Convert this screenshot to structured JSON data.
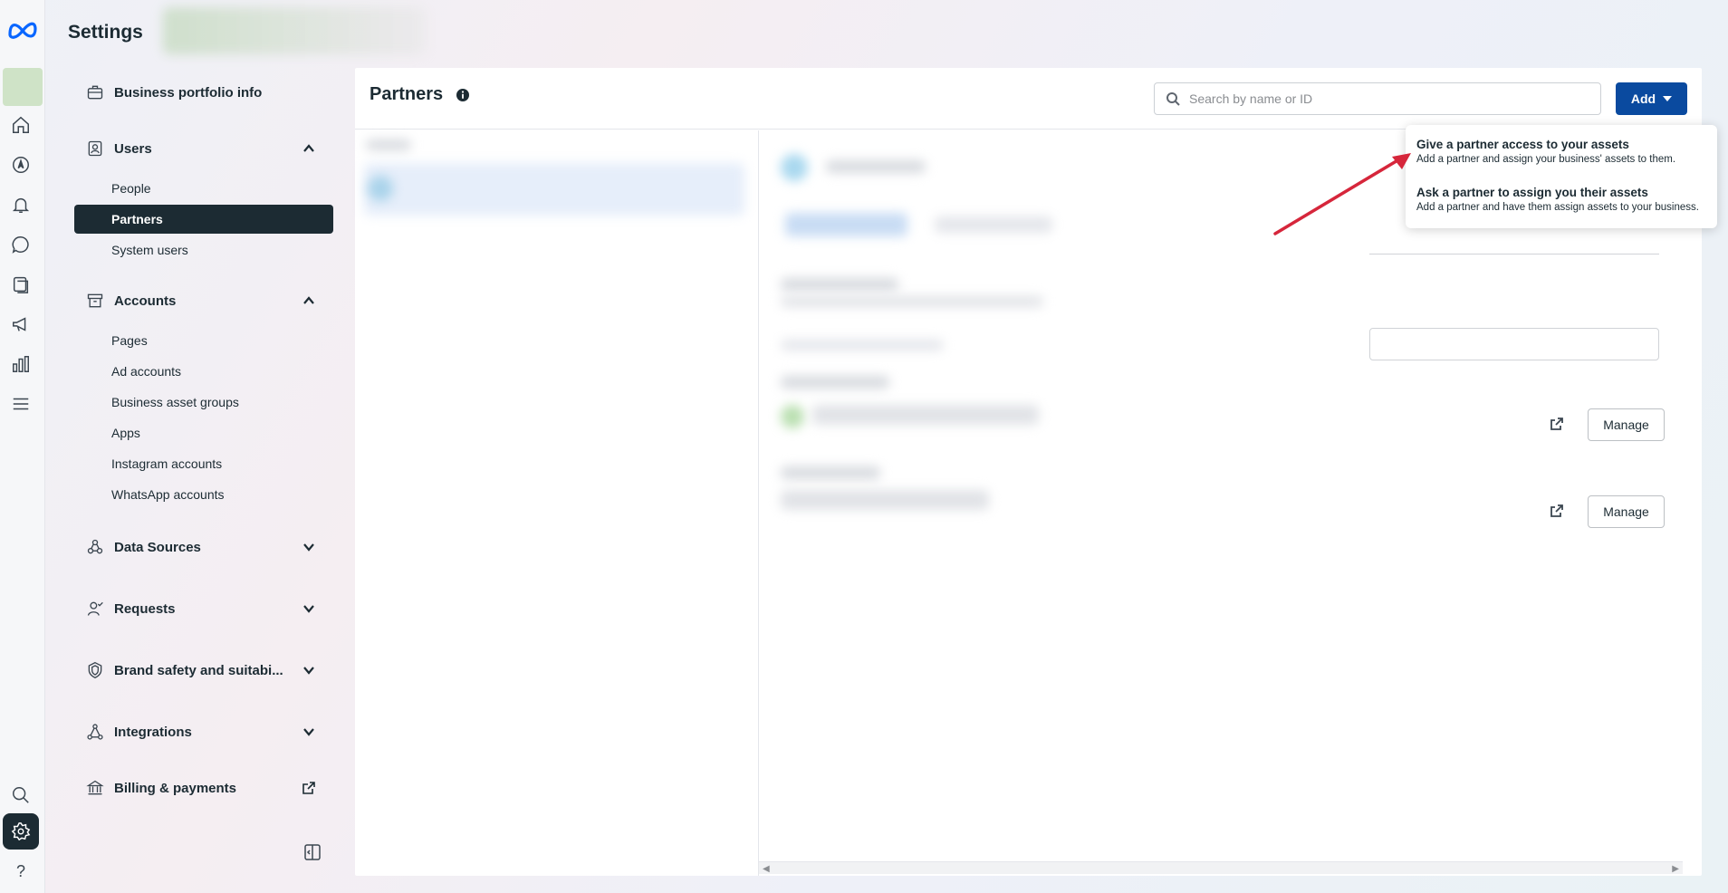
{
  "app": {
    "title": "Settings"
  },
  "rail": {
    "icons": [
      "meta-logo-icon",
      "home-icon",
      "explore-icon",
      "notifications-icon",
      "messages-icon",
      "pages-icon",
      "ads-icon",
      "insights-icon",
      "menu-icon",
      "search-icon",
      "settings-icon",
      "help-icon"
    ],
    "help_label": "?"
  },
  "sidebar": {
    "business_info": "Business portfolio info",
    "users": {
      "label": "Users",
      "items": [
        "People",
        "Partners",
        "System users"
      ],
      "active": "Partners"
    },
    "accounts": {
      "label": "Accounts",
      "items": [
        "Pages",
        "Ad accounts",
        "Business asset groups",
        "Apps",
        "Instagram accounts",
        "WhatsApp accounts"
      ]
    },
    "data_sources": "Data Sources",
    "requests": "Requests",
    "brand_safety": "Brand safety and suitabi...",
    "integrations": "Integrations",
    "billing": "Billing & payments"
  },
  "main": {
    "title": "Partners",
    "search_placeholder": "Search by name or ID",
    "add_label": "Add",
    "manage_label": "Manage"
  },
  "dropdown": {
    "items": [
      {
        "title": "Give a partner access to your assets",
        "desc": "Add a partner and assign your business' assets to them."
      },
      {
        "title": "Ask a partner to assign you their assets",
        "desc": "Add a partner and have them assign assets to your business."
      }
    ]
  },
  "colors": {
    "primary": "#0a4a9f",
    "dark": "#1c2b33",
    "annotation_arrow": "#d6263b"
  }
}
